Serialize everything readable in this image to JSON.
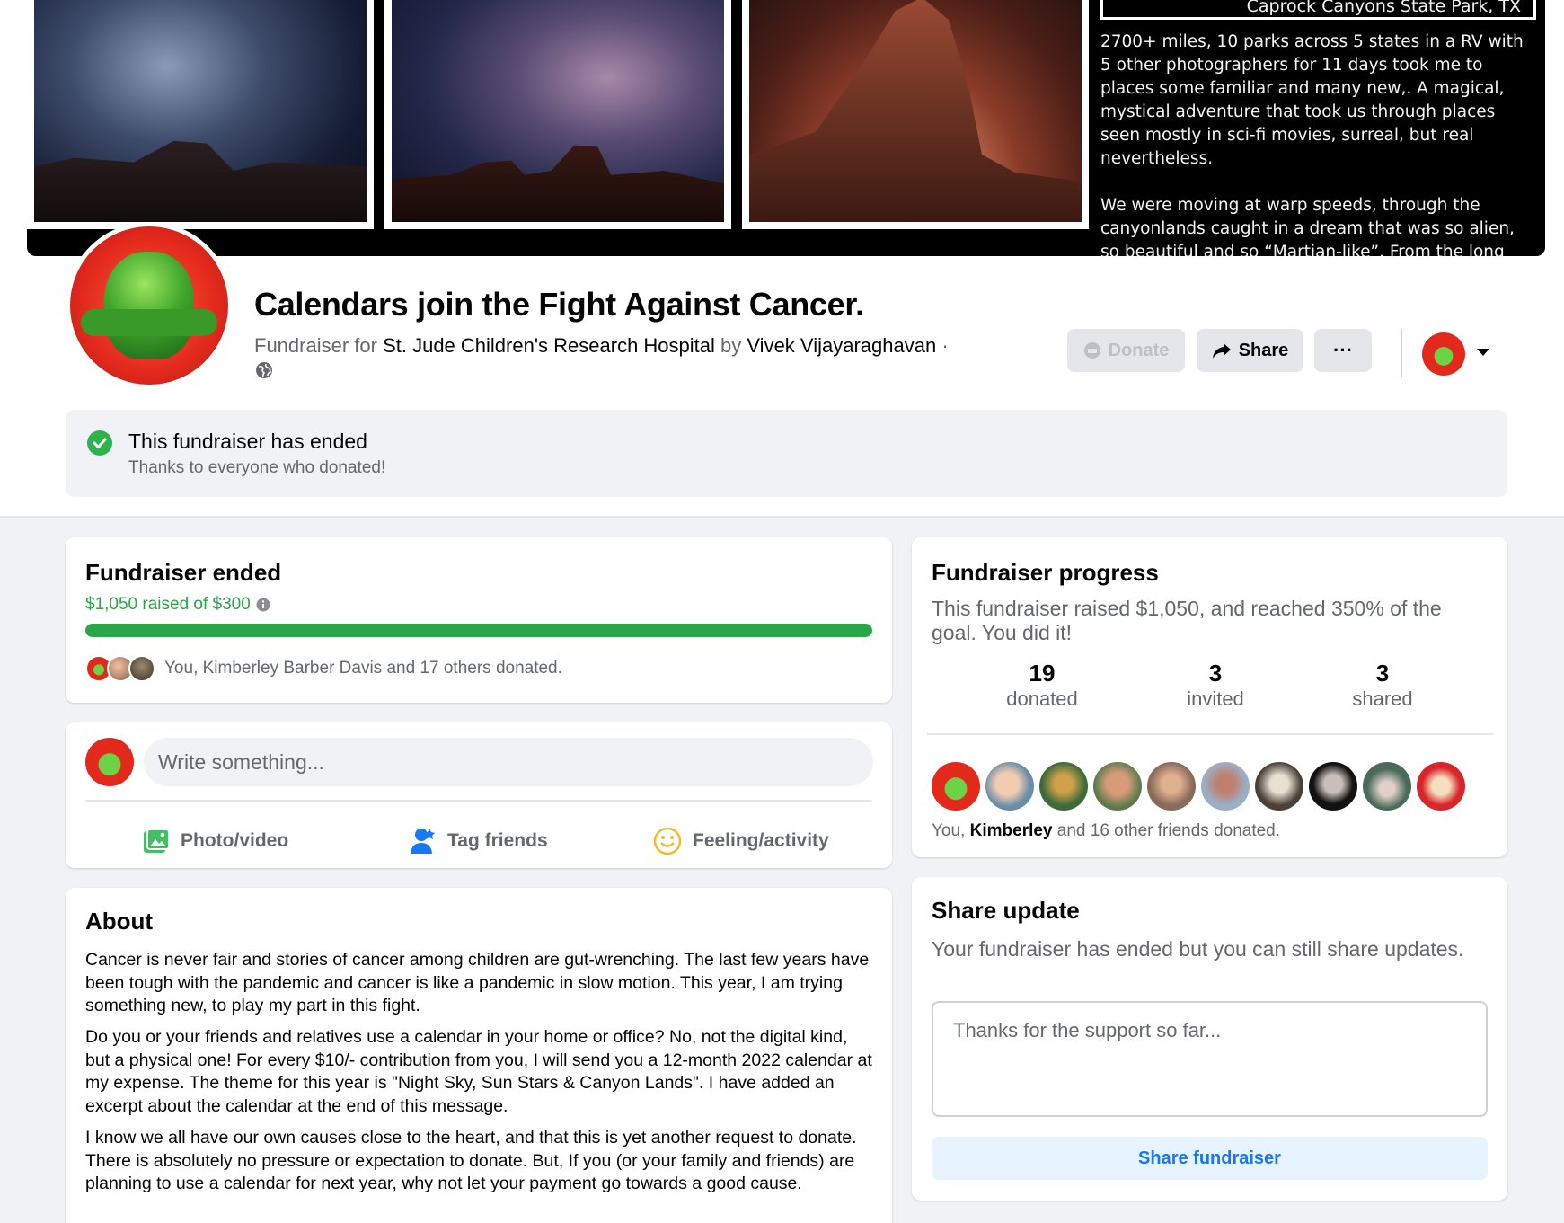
{
  "cover": {
    "caption": "Caprock Canyons State Park, TX",
    "paragraph1": "2700+ miles, 10 parks across 5 states in a RV with 5 other photographers for 11 days took me to places some familiar and many new,. A magical, mystical adventure that took us through places seen mostly in sci-fi movies, surreal, but real nevertheless.",
    "paragraph2": "We were moving at warp speeds, through the canyonlands caught in a dream that was so alien, so beautiful and so “Martian-like”. From the long"
  },
  "header": {
    "title": "Calendars join the Fight Against Cancer.",
    "fundraiser_for": "Fundraiser for",
    "organization": "St. Jude Children's Research Hospital",
    "by": "by",
    "organizer": "Vivek Vijayaraghavan",
    "separator": "·",
    "donate_label": "Donate",
    "share_label": "Share",
    "more_label": "···"
  },
  "banner": {
    "title": "This fundraiser has ended",
    "subtitle": "Thanks to everyone who donated!"
  },
  "fundraiser_card": {
    "title": "Fundraiser ended",
    "raised": "$1,050 raised of $300",
    "progress_fraction": 1.0,
    "donors_text": "You, Kimberley Barber Davis and 17 others donated."
  },
  "composer": {
    "placeholder": "Write something...",
    "photo_label": "Photo/video",
    "tag_label": "Tag friends",
    "feeling_label": "Feeling/activity"
  },
  "about": {
    "title": "About",
    "p1": "Cancer is never fair and stories of cancer among children are gut-wrenching. The last few years have been tough with the pandemic and cancer is like a pandemic in slow motion. This year, I am trying something new, to play my part in this fight.",
    "p2": "Do you or your friends and relatives use a calendar in your home or office? No, not the digital kind, but a physical one! For every $10/- contribution from you, I will send you a 12-month 2022 calendar at my expense. The theme for this year is \"Night Sky, Sun Stars & Canyon Lands\". I have added an excerpt about the calendar at the end of this message.",
    "p3": "I know we all have our own causes close to the heart, and that this is yet another request to donate. There is absolutely no pressure or expectation to donate. But, If you (or your family and friends) are planning to use a calendar for next year, why not let your payment go towards a good cause."
  },
  "progress": {
    "title": "Fundraiser progress",
    "text": "This fundraiser raised $1,050, and reached 350% of the goal. You did it!",
    "stats": [
      {
        "num": "19",
        "label": "donated"
      },
      {
        "num": "3",
        "label": "invited"
      },
      {
        "num": "3",
        "label": "shared"
      }
    ],
    "friends_prefix": "You, ",
    "friends_name": "Kimberley",
    "friends_suffix": " and 16 other friends donated."
  },
  "share_update": {
    "title": "Share update",
    "subtitle": "Your fundraiser has ended but you can still share updates.",
    "placeholder": "Thanks for the support so far...",
    "button_label": "Share fundraiser"
  },
  "colors": {
    "accent_green": "#2aa548",
    "link_blue": "#1877f2"
  }
}
